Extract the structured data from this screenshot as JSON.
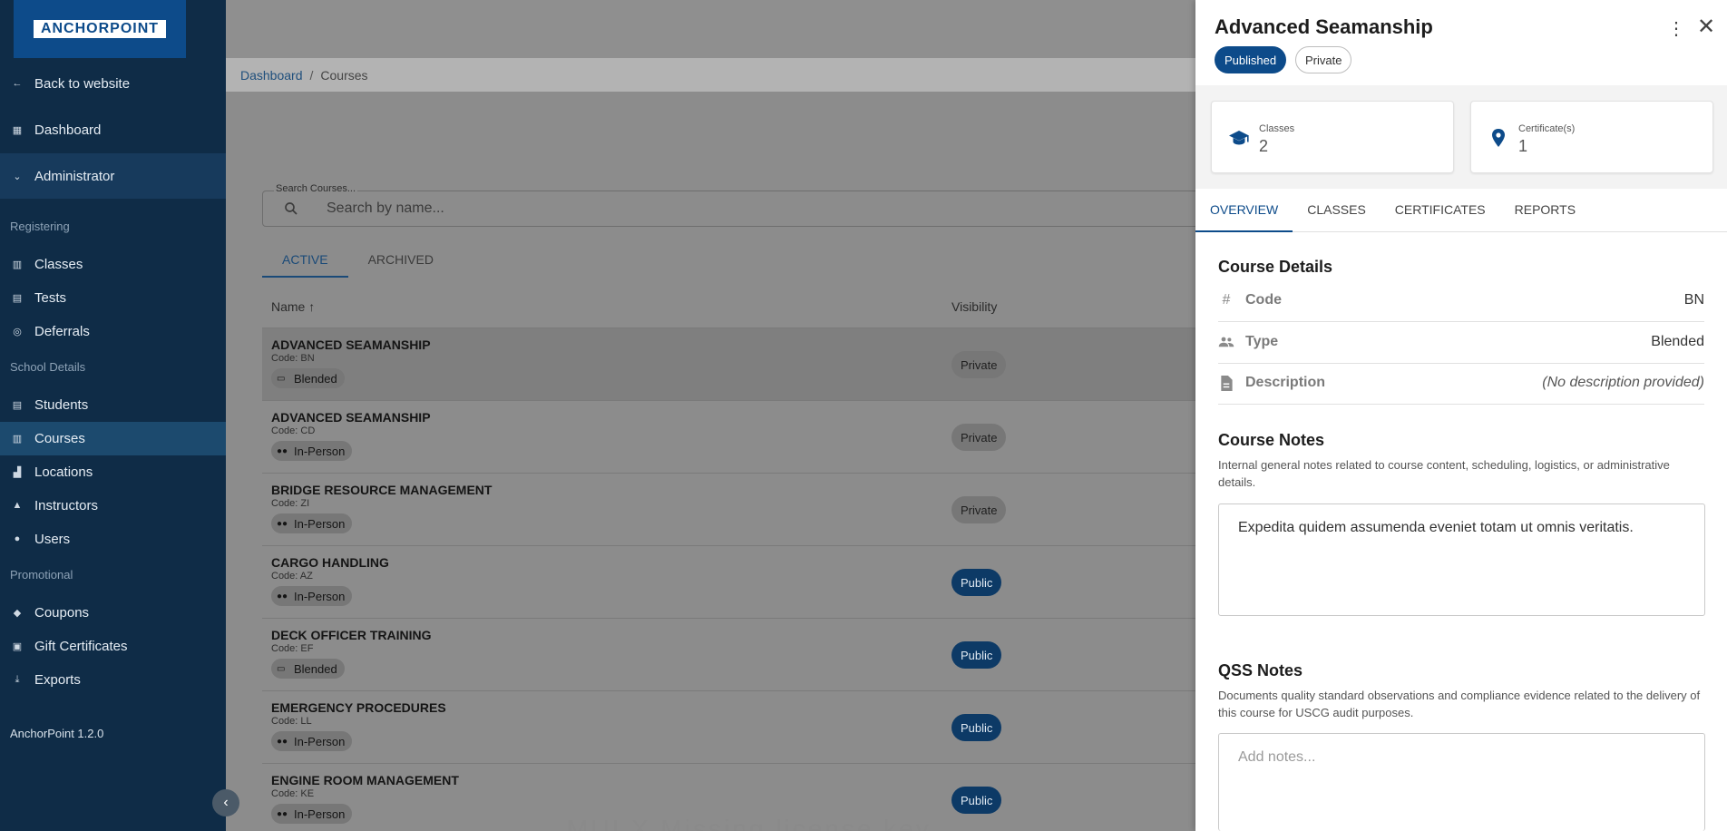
{
  "sidebar": {
    "logo": "ANCHORPOINT",
    "back": "Back to website",
    "dashboard": "Dashboard",
    "administrator": "Administrator",
    "sections": {
      "registering": "Registering",
      "school_details": "School Details",
      "promotional": "Promotional"
    },
    "items": {
      "classes": "Classes",
      "tests": "Tests",
      "deferrals": "Deferrals",
      "students": "Students",
      "courses": "Courses",
      "locations": "Locations",
      "instructors": "Instructors",
      "users": "Users",
      "coupons": "Coupons",
      "gift_certificates": "Gift Certificates",
      "exports": "Exports"
    },
    "version": "AnchorPoint 1.2.0"
  },
  "breadcrumb": {
    "home": "Dashboard",
    "sep": "/",
    "current": "Courses"
  },
  "search": {
    "label": "Search Courses...",
    "placeholder": "Search by name..."
  },
  "tabs": {
    "active": "ACTIVE",
    "archived": "ARCHIVED"
  },
  "table": {
    "col_name": "Name",
    "col_visibility": "Visibility",
    "rows": [
      {
        "title": "ADVANCED SEAMANSHIP",
        "code": "Code: BN",
        "type": "Blended",
        "visibility": "Private"
      },
      {
        "title": "ADVANCED SEAMANSHIP",
        "code": "Code: CD",
        "type": "In-Person",
        "visibility": "Private"
      },
      {
        "title": "BRIDGE RESOURCE MANAGEMENT",
        "code": "Code: ZI",
        "type": "In-Person",
        "visibility": "Private"
      },
      {
        "title": "CARGO HANDLING",
        "code": "Code: AZ",
        "type": "In-Person",
        "visibility": "Public"
      },
      {
        "title": "DECK OFFICER TRAINING",
        "code": "Code: EF",
        "type": "Blended",
        "visibility": "Public"
      },
      {
        "title": "EMERGENCY PROCEDURES",
        "code": "Code: LL",
        "type": "In-Person",
        "visibility": "Public"
      },
      {
        "title": "ENGINE ROOM MANAGEMENT",
        "code": "Code: KE",
        "type": "In-Person",
        "visibility": "Public"
      }
    ]
  },
  "watermark": "MUI X Missing license key",
  "drawer": {
    "title": "Advanced Seamanship",
    "status": "Published",
    "visibility": "Private",
    "stats": {
      "classes_label": "Classes",
      "classes_value": "2",
      "certs_label": "Certificate(s)",
      "certs_value": "1"
    },
    "tabs": {
      "overview": "OVERVIEW",
      "classes": "CLASSES",
      "certificates": "CERTIFICATES",
      "reports": "REPORTS"
    },
    "details": {
      "title": "Course Details",
      "code_label": "Code",
      "code_value": "BN",
      "type_label": "Type",
      "type_value": "Blended",
      "desc_label": "Description",
      "desc_value": "(No description provided)"
    },
    "course_notes": {
      "title": "Course Notes",
      "desc": "Internal general notes related to course content, scheduling, logistics, or administrative details.",
      "value": "Expedita quidem assumenda eveniet totam ut omnis veritatis."
    },
    "qss_notes": {
      "title": "QSS Notes",
      "desc": "Documents quality standard observations and compliance evidence related to the delivery of this course for USCG audit purposes.",
      "placeholder": "Add notes..."
    }
  },
  "colors": {
    "primary": "#0d4b8a",
    "sidebar": "#0f2c47",
    "public_badge": "#0d3a66"
  }
}
